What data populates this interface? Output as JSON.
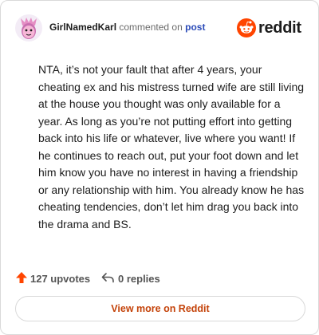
{
  "comment": {
    "author": "GirlNamedKarl",
    "action_text": "commented on",
    "post_link": "post",
    "body": "NTA, it’s not your fault that after 4 years, your cheating ex and his mistress turned wife are still living at the house you thought was only available for a year. As long as you’re not putting effort into getting back into his life or whatever, live where you want! If he continues to reach out, put your foot down and let him know you have no interest in having a friendship or any relationship with him. You already know he has cheating tendencies, don’t let him drag you back into the drama and BS."
  },
  "brand": {
    "name": "reddit",
    "icon": "reddit-snoo-icon",
    "color": "#ff4500"
  },
  "footer": {
    "upvotes_label": "127 upvotes",
    "upvote_icon": "upvote-arrow-icon",
    "replies_label": "0 replies",
    "reply_icon": "reply-arrow-icon"
  },
  "actions": {
    "view_more_label": "View more on Reddit"
  },
  "colors": {
    "accent": "#c4430a",
    "link": "#2b4bb8",
    "border": "#d9d9d9"
  }
}
